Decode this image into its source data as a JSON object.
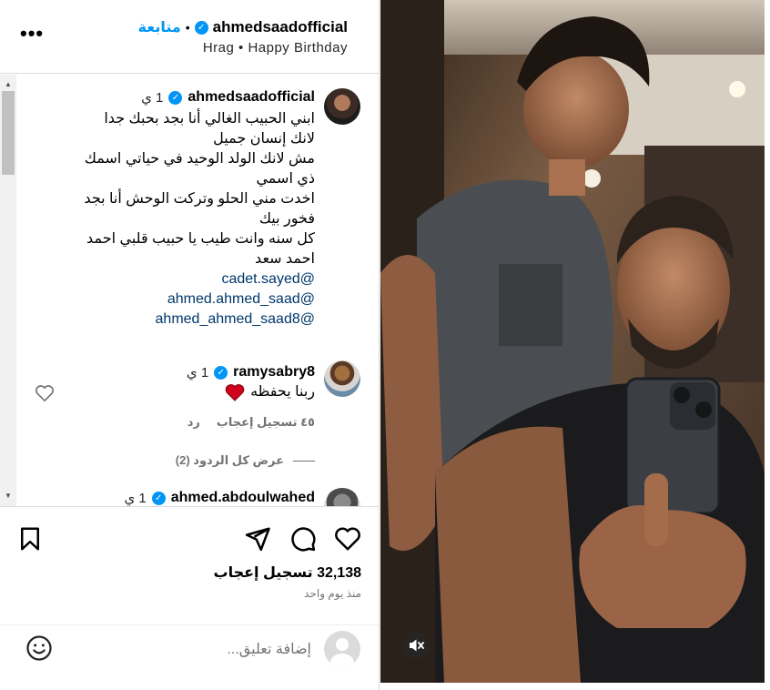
{
  "header": {
    "username": "ahmedsaadofficial",
    "follow_label": "متابعة",
    "subtitle": "Hrag • Happy Birthday",
    "more_icon": "more-horizontal-icon"
  },
  "caption": {
    "username": "ahmedsaadofficial",
    "time": "1 ي",
    "lines": [
      "ابني الحبيب الغالي أنا بجد بحبك جدا",
      "لانك إنسان جميل",
      "مش لانك الولد الوحيد في حياتي اسمك",
      "ذي اسمي",
      "اخدت مني الحلو وتركت الوحش أنا بجد",
      "فخور بيك",
      "كل سنه وانت طيب يا حبيب قلبي احمد",
      "احمد سعد"
    ],
    "mentions": [
      "@cadet.sayed",
      "@ahmed.ahmed_saad",
      "@ahmed_ahmed_saad8"
    ]
  },
  "comments": [
    {
      "username": "ramysabry8",
      "time": "1 ي",
      "text": "ربنا يحفظه",
      "likes": "٤٥ تسجيل إعجاب",
      "reply": "رد",
      "view_replies": "عرض كل الردود (2)"
    },
    {
      "username": "ahmed.abdoulwahed",
      "time": "1 ي"
    }
  ],
  "actions": {
    "likes": "32,138 تسجيل إعجاب",
    "time_ago": "منذ يوم واحد"
  },
  "add_comment": {
    "placeholder": "إضافة تعليق..."
  },
  "colors": {
    "accent": "#0095f6",
    "mention": "#00376b",
    "secondary_text": "#737373",
    "border": "#dbdbdb",
    "heart_red": "#ed1c24"
  }
}
